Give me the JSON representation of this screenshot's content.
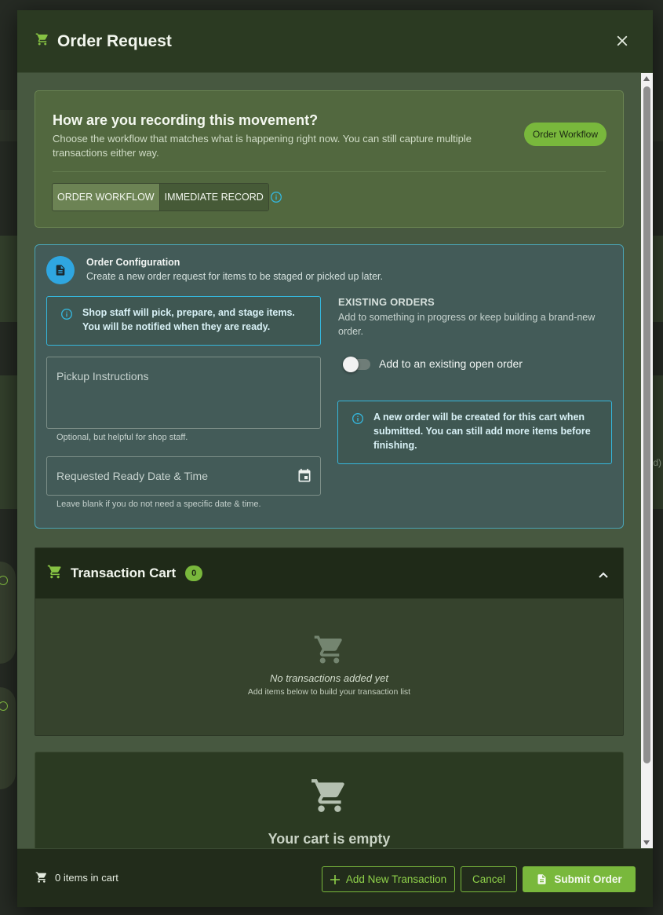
{
  "modal": {
    "title": "Order Request",
    "close_label": "×"
  },
  "workflow": {
    "heading": "How are you recording this movement?",
    "description": "Choose the workflow that matches what is happening right now. You can still capture multiple transactions either way.",
    "badge": "Order Workflow",
    "options": [
      {
        "label": "ORDER WORKFLOW",
        "selected": true
      },
      {
        "label": "IMMEDIATE RECORD",
        "selected": false
      }
    ]
  },
  "config": {
    "title": "Order Configuration",
    "subtitle": "Create a new order request for items to be staged or picked up later.",
    "staff_info": "Shop staff will pick, prepare, and stage items. You will be notified when they are ready.",
    "pickup_placeholder": "Pickup Instructions",
    "pickup_helper": "Optional, but helpful for shop staff.",
    "date_placeholder": "Requested Ready Date & Time",
    "date_helper": "Leave blank if you do not need a specific date & time.",
    "existing_title": "EXISTING ORDERS",
    "existing_desc": "Add to something in progress or keep building a brand-new order.",
    "existing_toggle_label": "Add to an existing open order",
    "existing_toggle_on": false,
    "new_order_info": "A new order will be created for this cart when submitted. You can still add more items before finishing."
  },
  "cart": {
    "title": "Transaction Cart",
    "count": "0",
    "empty_title": "No transactions added yet",
    "empty_sub": "Add items below to build your transaction list"
  },
  "empty_cart": {
    "title": "Your cart is empty"
  },
  "footer": {
    "items_in_cart": "0 items in cart",
    "add_label": "Add New Transaction",
    "cancel_label": "Cancel",
    "submit_label": "Submit Order"
  },
  "background": {
    "side_text": "d)"
  },
  "colors": {
    "accent_green": "#79b83c",
    "info_blue": "#35b6dc",
    "header_bg": "#2b3a22"
  }
}
